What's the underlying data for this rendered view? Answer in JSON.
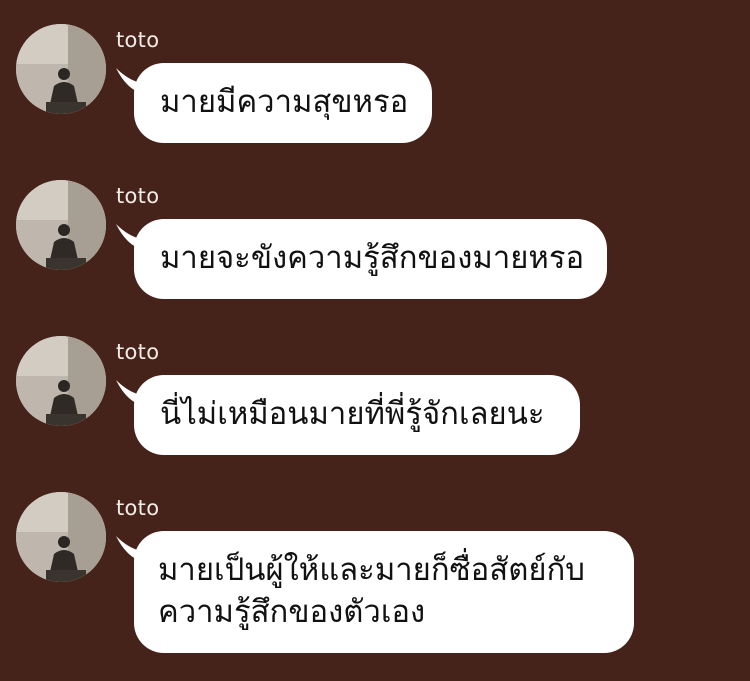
{
  "colors": {
    "background": "#46231a",
    "bubble": "#ffffff",
    "sender_text": "#f3ebe6",
    "message_text": "#111111"
  },
  "messages": [
    {
      "sender": "toto",
      "text": "มายมีความสุขหรอ"
    },
    {
      "sender": "toto",
      "text": "มายจะขังความรู้สึกของมายหรอ"
    },
    {
      "sender": "toto",
      "text": "นี่ไม่เหมือนมายที่พี่รู้จักเลยนะ"
    },
    {
      "sender": "toto",
      "text": "มายเป็นผู้ให้และมายก็ซื่อสัตย์กับความรู้สึกของตัวเอง"
    }
  ]
}
